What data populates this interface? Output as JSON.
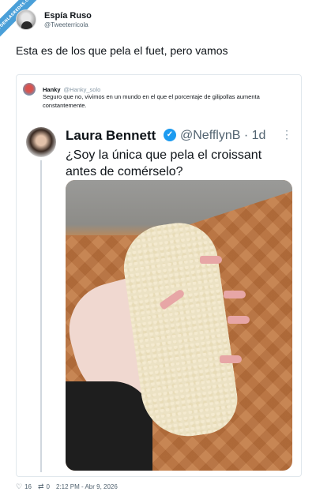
{
  "watermark": {
    "text": "VISTOENLASREDES.COM"
  },
  "post": {
    "display_name": "Espía Ruso",
    "handle": "@Tweeterricola",
    "text": "Esta es de los que pela el fuet, pero vamos"
  },
  "quote": {
    "display_name": "Hanky",
    "handle": "@Hanky_solo",
    "text": "Seguro que no, vivimos en un mundo en el que el porcentaje de gilipollas aumenta constantemente."
  },
  "inner_tweet": {
    "display_name": "Laura Bennett",
    "handle_time": "@NefflynB · 1d",
    "text": "¿Soy la única que pela el croissant antes de comérselo?"
  },
  "footer": {
    "likes": "16",
    "retweets": "0",
    "timestamp": "2:12 PM - Abr 9, 2026"
  },
  "icons": {
    "verified": "verified-badge-icon",
    "more": "more-options-icon",
    "heart": "heart-icon",
    "retweet": "retweet-icon"
  },
  "colors": {
    "verified": "#1d9bf0",
    "text_secondary": "#536471"
  }
}
